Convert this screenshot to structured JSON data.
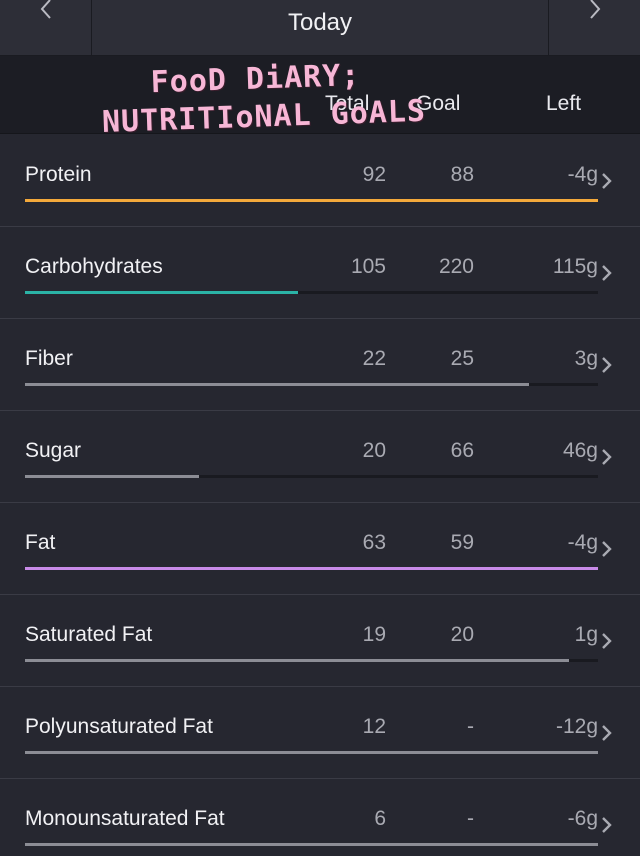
{
  "header": {
    "title": "Today",
    "prev_icon": "chevron-left-icon",
    "next_icon": "chevron-right-icon"
  },
  "columns": {
    "total": "Total",
    "goal": "Goal",
    "left": "Left"
  },
  "sticker": {
    "line1": "FooD DiARY;",
    "line2": "NUTRITIoNAL GoALS"
  },
  "colors": {
    "over_goal": "#f4a93b",
    "carbs": "#2bb3a6",
    "fat": "#c88be8",
    "neutral": "#8c8d95"
  },
  "nutrients": [
    {
      "name": "Protein",
      "total": "92",
      "goal": "88",
      "left": "-4g",
      "progress": 1.0,
      "color": "#f4a93b"
    },
    {
      "name": "Carbohydrates",
      "total": "105",
      "goal": "220",
      "left": "115g",
      "progress": 0.477,
      "color": "#2bb3a6"
    },
    {
      "name": "Fiber",
      "total": "22",
      "goal": "25",
      "left": "3g",
      "progress": 0.88,
      "color": "#8c8d95"
    },
    {
      "name": "Sugar",
      "total": "20",
      "goal": "66",
      "left": "46g",
      "progress": 0.303,
      "color": "#8c8d95"
    },
    {
      "name": "Fat",
      "total": "63",
      "goal": "59",
      "left": "-4g",
      "progress": 1.0,
      "color": "#c88be8"
    },
    {
      "name": "Saturated Fat",
      "total": "19",
      "goal": "20",
      "left": "1g",
      "progress": 0.95,
      "color": "#8c8d95"
    },
    {
      "name": "Polyunsaturated Fat",
      "total": "12",
      "goal": "-",
      "left": "-12g",
      "progress": 1.0,
      "color": "#8c8d95"
    },
    {
      "name": "Monounsaturated Fat",
      "total": "6",
      "goal": "-",
      "left": "-6g",
      "progress": 1.0,
      "color": "#8c8d95"
    }
  ]
}
